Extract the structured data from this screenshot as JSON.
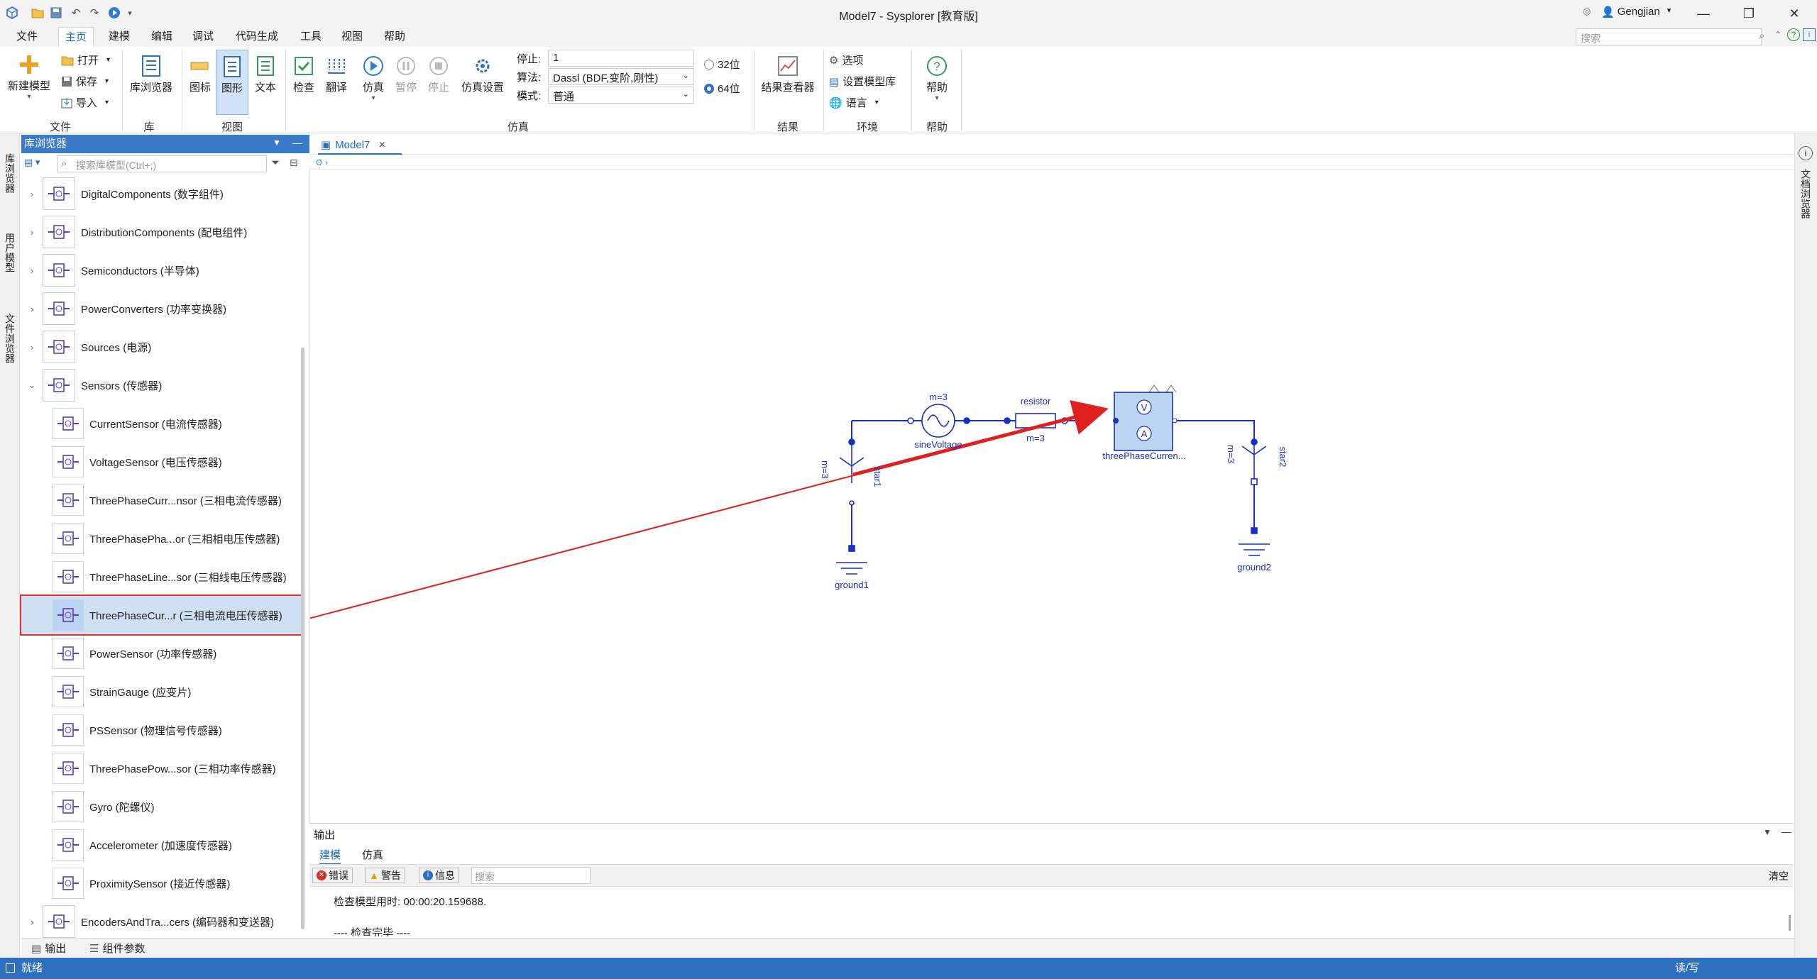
{
  "window": {
    "title": "Model7 - Sysplorer [教育版]",
    "user": "Gengjian",
    "search_placeholder": "搜索"
  },
  "menus": [
    "文件",
    "主页",
    "建模",
    "编辑",
    "调试",
    "代码生成",
    "工具",
    "视图",
    "帮助"
  ],
  "active_menu": "主页",
  "ribbon": {
    "file": {
      "new_model": "新建模型",
      "open": "打开",
      "save": "保存",
      "import": "导入",
      "group": "文件"
    },
    "library": {
      "browser": "库浏览器",
      "group": "库"
    },
    "view": {
      "icon": "图标",
      "diagram": "图形",
      "text": "文本",
      "group": "视图"
    },
    "sim": {
      "check": "检查",
      "translate": "翻译",
      "simulate": "仿真",
      "pause": "暂停",
      "stop": "停止",
      "settings": "仿真设置",
      "group": "仿真"
    },
    "sim_params": {
      "stop_label": "停止:",
      "stop_value": "1",
      "algo_label": "算法:",
      "algo_value": "Dassl (BDF,变阶,刚性)",
      "mode_label": "模式:",
      "mode_value": "普通",
      "bit32": "32位",
      "bit64": "64位",
      "selected_bits": "64位"
    },
    "results": {
      "viewer": "结果查看器",
      "group": "结果"
    },
    "env": {
      "options": "选项",
      "set_lib": "设置模型库",
      "lang": "语言",
      "group": "环境"
    },
    "help": {
      "help": "帮助",
      "group": "帮助"
    }
  },
  "side_tabs_left": [
    "库浏览器",
    "用户模型",
    "文件浏览器"
  ],
  "side_tabs_right": [
    "文档浏览器"
  ],
  "library_panel": {
    "title": "库浏览器",
    "search_placeholder": "搜索库模型(Ctrl+;)",
    "items": [
      {
        "label": "DigitalComponents (数字组件)",
        "level": 0,
        "expand": "collapsed"
      },
      {
        "label": "DistributionComponents (配电组件)",
        "level": 0,
        "expand": "collapsed"
      },
      {
        "label": "Semiconductors (半导体)",
        "level": 0,
        "expand": "collapsed"
      },
      {
        "label": "PowerConverters (功率变换器)",
        "level": 0,
        "expand": "collapsed"
      },
      {
        "label": "Sources (电源)",
        "level": 0,
        "expand": "collapsed"
      },
      {
        "label": "Sensors (传感器)",
        "level": 0,
        "expand": "expanded"
      },
      {
        "label": "CurrentSensor (电流传感器)",
        "level": 1
      },
      {
        "label": "VoltageSensor (电压传感器)",
        "level": 1
      },
      {
        "label": "ThreePhaseCurr...nsor (三相电流传感器)",
        "level": 1
      },
      {
        "label": "ThreePhasePha...or (三相相电压传感器)",
        "level": 1
      },
      {
        "label": "ThreePhaseLine...sor (三相线电压传感器)",
        "level": 1
      },
      {
        "label": "ThreePhaseCur...r (三相电流电压传感器)",
        "level": 1,
        "selected": true
      },
      {
        "label": "PowerSensor (功率传感器)",
        "level": 1
      },
      {
        "label": "StrainGauge (应变片)",
        "level": 1
      },
      {
        "label": "PSSensor (物理信号传感器)",
        "level": 1
      },
      {
        "label": "ThreePhasePow...sor (三相功率传感器)",
        "level": 1
      },
      {
        "label": "Gyro (陀螺仪)",
        "level": 1
      },
      {
        "label": "Accelerometer (加速度传感器)",
        "level": 1
      },
      {
        "label": "ProximitySensor (接近传感器)",
        "level": 1
      },
      {
        "label": "EncodersAndTra...cers (编码器和变送器)",
        "level": 0,
        "expand": "collapsed"
      }
    ]
  },
  "document_tab": "Model7",
  "diagram": {
    "labels": {
      "sine_m": "m=3",
      "sine_name": "sineVoltage",
      "resistor_name": "resistor",
      "resistor_m": "m=3",
      "sensor_name": "threePhaseCurren...",
      "star1_m": "m=3",
      "star1_name": "star1",
      "star2_m": "m=3",
      "star2_name": "star2",
      "ground1": "ground1",
      "ground2": "ground2",
      "sensor_v": "V",
      "sensor_a": "A"
    },
    "arrow_color": "#e02020",
    "wire_color": "#1a2fc4"
  },
  "output_panel": {
    "title": "输出",
    "tabs": [
      "建模",
      "仿真"
    ],
    "active_tab": "建模",
    "filters": {
      "error": "错误",
      "warning": "警告",
      "info": "信息"
    },
    "search_placeholder": "搜索",
    "clear": "清空",
    "lines": [
      "检查模型用时: 00:00:20.159688.",
      "---- 检查完毕 ----"
    ]
  },
  "bottom_tabs": [
    "输出",
    "组件参数"
  ],
  "status": {
    "left": "就绪",
    "right": "读/写"
  }
}
